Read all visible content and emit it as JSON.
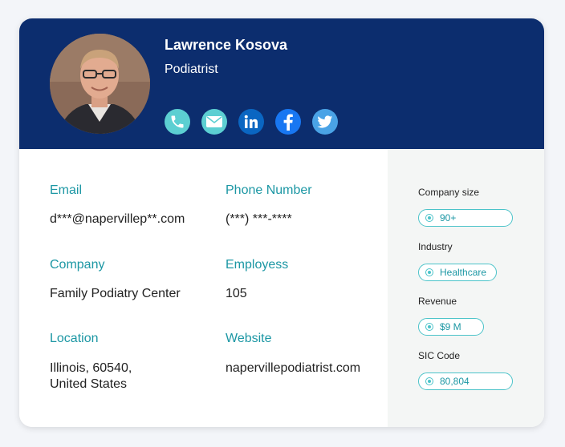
{
  "profile": {
    "name": "Lawrence Kosova",
    "title": "Podiatrist"
  },
  "socials": [
    {
      "name": "phone-icon",
      "color": "#5ccfd2"
    },
    {
      "name": "email-icon",
      "color": "#5ccfd2"
    },
    {
      "name": "linkedin-icon",
      "color": "#0a66c2"
    },
    {
      "name": "facebook-icon",
      "color": "#1877f2"
    },
    {
      "name": "twitter-icon",
      "color": "#4aa3e6"
    }
  ],
  "fields": {
    "email": {
      "label": "Email",
      "value": "d***@napervillep**.com"
    },
    "phone": {
      "label": "Phone Number",
      "value": "(***) ***-****"
    },
    "company": {
      "label": "Company",
      "value": "Family Podiatry Center"
    },
    "employees": {
      "label": "Employess",
      "value": "105"
    },
    "location": {
      "label": "Location",
      "value_line1": "Illinois, 60540,",
      "value_line2": "United States"
    },
    "website": {
      "label": "Website",
      "value": "napervillepodiatrist.com"
    }
  },
  "side": {
    "company_size": {
      "label": "Company size",
      "value": "90+"
    },
    "industry": {
      "label": "Industry",
      "value": "Healthcare"
    },
    "revenue": {
      "label": "Revenue",
      "value": "$9 M"
    },
    "sic_code": {
      "label": "SIC Code",
      "value": "80,804"
    }
  },
  "colors": {
    "header_bg": "#0c2d6e",
    "accent": "#1c97a4",
    "pill_border": "#4bc3c9",
    "side_bg": "#f4f6f5"
  }
}
